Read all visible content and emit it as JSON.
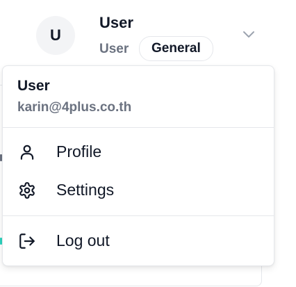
{
  "header": {
    "avatar_initial": "U",
    "name": "User",
    "role": "User",
    "badge": "General",
    "icons": {
      "dropdown": "chevron-down-icon"
    }
  },
  "menu": {
    "name": "User",
    "email": "karin@4plus.co.th",
    "items": [
      {
        "label": "Profile",
        "icon": "user-icon"
      },
      {
        "label": "Settings",
        "icon": "gear-icon"
      },
      {
        "label": "Log out",
        "icon": "log-out-icon"
      }
    ]
  },
  "colors": {
    "text": "#111827",
    "muted": "#6b7280",
    "border": "#e5e7eb",
    "avatar_bg": "#f3f4f6"
  }
}
